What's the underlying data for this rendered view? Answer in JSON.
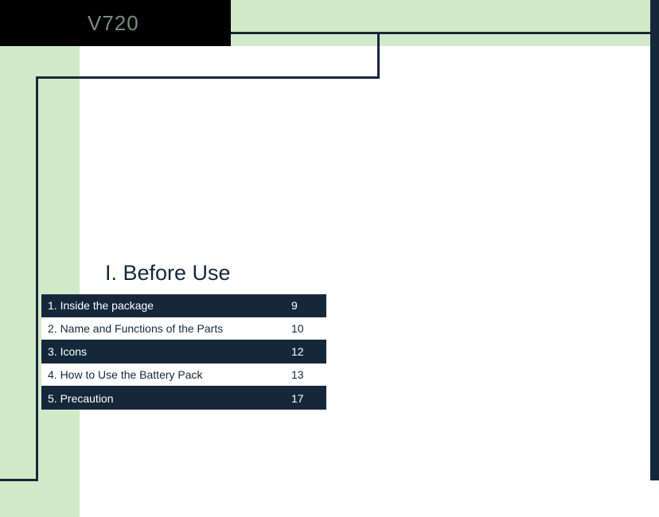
{
  "header": {
    "model": "V720"
  },
  "section": {
    "heading": "I. Before Use"
  },
  "toc": [
    {
      "title": "1. Inside the package",
      "page": "9",
      "variant": "dark"
    },
    {
      "title": "2. Name and Functions of the Parts",
      "page": "10",
      "variant": "light"
    },
    {
      "title": "3. Icons",
      "page": "12",
      "variant": "dark"
    },
    {
      "title": "4. How to Use the Battery Pack",
      "page": "13",
      "variant": "light"
    },
    {
      "title": "5. Precaution",
      "page": "17",
      "variant": "dark"
    }
  ],
  "colors": {
    "page_bg": "#d2e9c9",
    "dark": "#15283b",
    "header_text": "#7a8d7b"
  }
}
